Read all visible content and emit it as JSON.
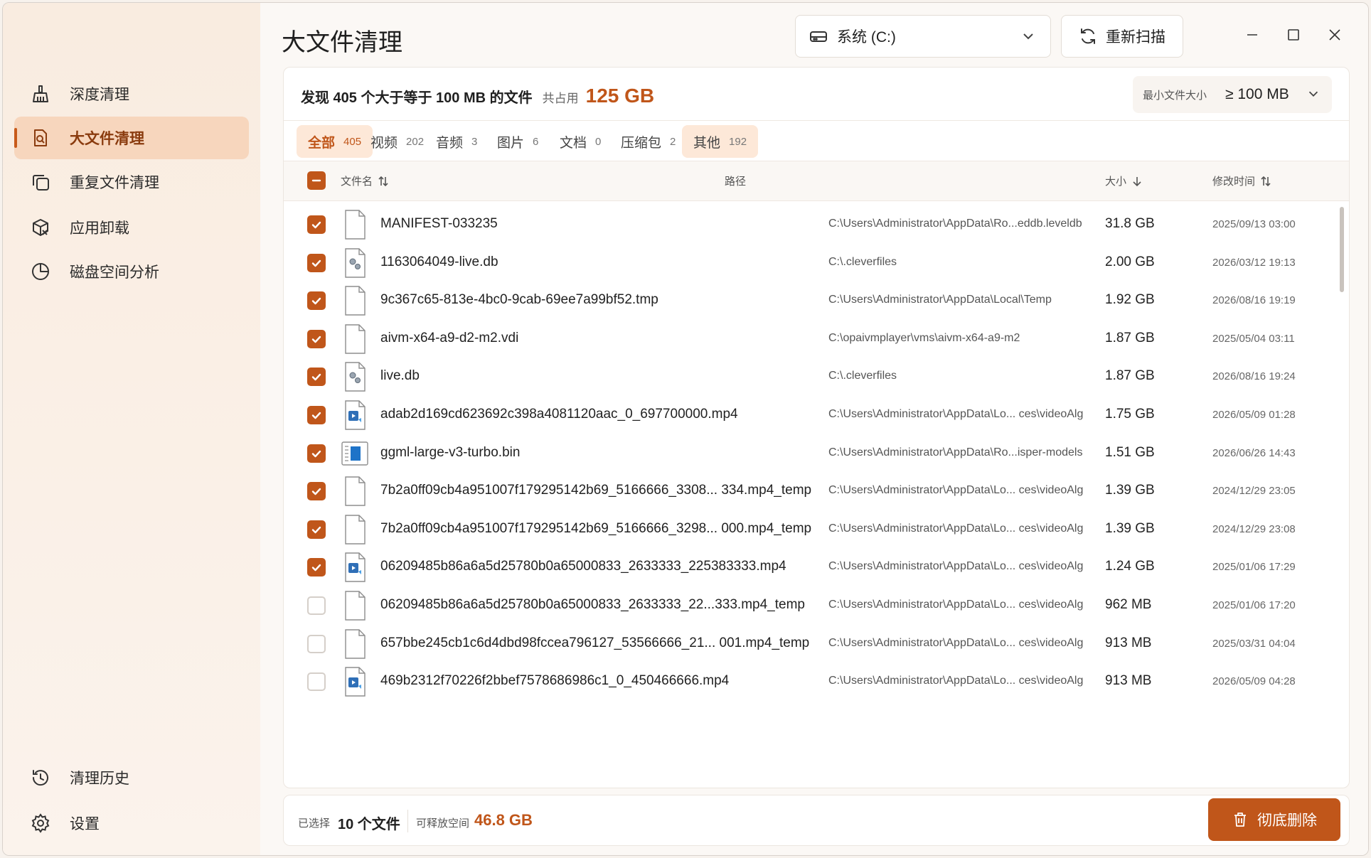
{
  "sidebar": {
    "items": [
      {
        "label": "深度清理",
        "icon": "broom-icon"
      },
      {
        "label": "大文件清理",
        "icon": "file-search-icon",
        "active": true
      },
      {
        "label": "重复文件清理",
        "icon": "copy-icon"
      },
      {
        "label": "应用卸载",
        "icon": "package-icon"
      },
      {
        "label": "磁盘空间分析",
        "icon": "pie-chart-icon"
      }
    ],
    "bottom": [
      {
        "label": "清理历史",
        "icon": "history-icon"
      },
      {
        "label": "设置",
        "icon": "gear-icon"
      }
    ]
  },
  "header": {
    "title": "大文件清理",
    "drive": "系统 (C:)",
    "rescan": "重新扫描"
  },
  "summary": {
    "found": "发现 405 个大于等于 100 MB 的文件",
    "occupied_label": "共占用",
    "occupied_value": "125 GB",
    "min_size_label": "最小文件大小",
    "min_size_value": "≥ 100 MB"
  },
  "tabs": [
    {
      "label": "全部",
      "count": "405",
      "active": true
    },
    {
      "label": "视频",
      "count": "202"
    },
    {
      "label": "音频",
      "count": "3"
    },
    {
      "label": "图片",
      "count": "6"
    },
    {
      "label": "文档",
      "count": "0"
    },
    {
      "label": "压缩包",
      "count": "2"
    },
    {
      "label": "其他",
      "count": "192",
      "highlight": true
    }
  ],
  "table": {
    "headers": {
      "name": "文件名",
      "path": "路径",
      "size": "大小",
      "date": "修改时间"
    },
    "rows": [
      {
        "checked": true,
        "icon": "blank",
        "name": "MANIFEST-033235",
        "path": "C:\\Users\\Administrator\\AppData\\Ro...eddb.leveldb",
        "size": "31.8 GB",
        "date": "2025/09/13 03:00"
      },
      {
        "checked": true,
        "icon": "gear",
        "name": "1163064049-live.db",
        "path": "C:\\.cleverfiles",
        "size": "2.00 GB",
        "date": "2026/03/12 19:13"
      },
      {
        "checked": true,
        "icon": "blank",
        "name": "9c367c65-813e-4bc0-9cab-69ee7a99bf52.tmp",
        "path": "C:\\Users\\Administrator\\AppData\\Local\\Temp",
        "size": "1.92 GB",
        "date": "2026/08/16 19:19"
      },
      {
        "checked": true,
        "icon": "blank",
        "name": "aivm-x64-a9-d2-m2.vdi",
        "path": "C:\\opaivmplayer\\vms\\aivm-x64-a9-m2",
        "size": "1.87 GB",
        "date": "2025/05/04 03:11"
      },
      {
        "checked": true,
        "icon": "gear",
        "name": "live.db",
        "path": "C:\\.cleverfiles",
        "size": "1.87 GB",
        "date": "2026/08/16 19:24"
      },
      {
        "checked": true,
        "icon": "media",
        "name": "adab2d169cd623692c398a4081120aac_0_697700000.mp4",
        "path": "C:\\Users\\Administrator\\AppData\\Lo... ces\\videoAlg",
        "size": "1.75 GB",
        "date": "2026/05/09 01:28"
      },
      {
        "checked": true,
        "icon": "bin",
        "name": "ggml-large-v3-turbo.bin",
        "path": "C:\\Users\\Administrator\\AppData\\Ro...isper-models",
        "size": "1.51 GB",
        "date": "2026/06/26 14:43"
      },
      {
        "checked": true,
        "icon": "blank",
        "name": "7b2a0ff09cb4a951007f179295142b69_5166666_3308... 334.mp4_temp",
        "path": "C:\\Users\\Administrator\\AppData\\Lo... ces\\videoAlg",
        "size": "1.39 GB",
        "date": "2024/12/29 23:05"
      },
      {
        "checked": true,
        "icon": "blank",
        "name": "7b2a0ff09cb4a951007f179295142b69_5166666_3298... 000.mp4_temp",
        "path": "C:\\Users\\Administrator\\AppData\\Lo... ces\\videoAlg",
        "size": "1.39 GB",
        "date": "2024/12/29 23:08"
      },
      {
        "checked": true,
        "icon": "media",
        "name": "06209485b86a6a5d25780b0a65000833_2633333_225383333.mp4",
        "path": "C:\\Users\\Administrator\\AppData\\Lo... ces\\videoAlg",
        "size": "1.24 GB",
        "date": "2025/01/06 17:29"
      },
      {
        "checked": false,
        "icon": "blank",
        "name": "06209485b86a6a5d25780b0a65000833_2633333_22...333.mp4_temp",
        "path": "C:\\Users\\Administrator\\AppData\\Lo... ces\\videoAlg",
        "size": "962 MB",
        "date": "2025/01/06 17:20"
      },
      {
        "checked": false,
        "icon": "blank",
        "name": "657bbe245cb1c6d4dbd98fccea796127_53566666_21... 001.mp4_temp",
        "path": "C:\\Users\\Administrator\\AppData\\Lo... ces\\videoAlg",
        "size": "913 MB",
        "date": "2025/03/31 04:04"
      },
      {
        "checked": false,
        "icon": "media",
        "name": "469b2312f70226f2bbef7578686986c1_0_450466666.mp4",
        "path": "C:\\Users\\Administrator\\AppData\\Lo... ces\\videoAlg",
        "size": "913 MB",
        "date": "2026/05/09 04:28"
      }
    ]
  },
  "footer": {
    "selected_label": "已选择",
    "selected_value": "10 个文件",
    "free_label": "可释放空间",
    "free_value": "46.8 GB",
    "delete": "彻底删除"
  },
  "colors": {
    "accent": "#c0561a",
    "accent_light": "#fde8d8",
    "sidebar_active": "#f7d6bd"
  }
}
